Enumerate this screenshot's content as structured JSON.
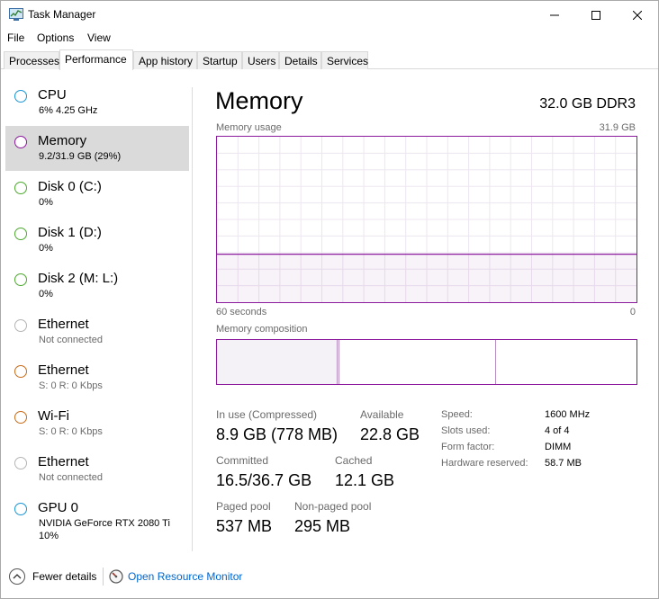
{
  "window": {
    "title": "Task Manager",
    "controls": {
      "minimize_icon": "minimize-icon",
      "maximize_icon": "maximize-icon",
      "close_icon": "close-icon"
    }
  },
  "menu": {
    "file": "File",
    "options": "Options",
    "view": "View"
  },
  "tabs": [
    "Processes",
    "Performance",
    "App history",
    "Startup",
    "Users",
    "Details",
    "Services"
  ],
  "active_tab": "Performance",
  "sidebar": {
    "items": [
      {
        "title": "CPU",
        "sub": "6% 4.25 GHz",
        "color": "#1a95d6"
      },
      {
        "title": "Memory",
        "sub": "9.2/31.9 GB (29%)",
        "color": "#8b1a9c"
      },
      {
        "title": "Disk 0 (C:)",
        "sub": "0%",
        "color": "#4da82e"
      },
      {
        "title": "Disk 1 (D:)",
        "sub": "0%",
        "color": "#4da82e"
      },
      {
        "title": "Disk 2 (M: L:)",
        "sub": "0%",
        "color": "#4da82e"
      },
      {
        "title": "Ethernet",
        "sub": "Not connected",
        "color": "#b4b4b4"
      },
      {
        "title": "Ethernet",
        "sub": "S: 0 R: 0 Kbps",
        "color": "#c96c1a"
      },
      {
        "title": "Wi-Fi",
        "sub": "S: 0 R: 0 Kbps",
        "color": "#c96c1a"
      },
      {
        "title": "Ethernet",
        "sub": "Not connected",
        "color": "#b4b4b4"
      },
      {
        "title": "GPU 0",
        "sub": "NVIDIA GeForce RTX 2080 Ti",
        "sub2": "10%",
        "color": "#1a95d6"
      }
    ]
  },
  "main": {
    "title": "Memory",
    "spec": "32.0 GB DDR3",
    "usage_label": "Memory usage",
    "usage_max": "31.9 GB",
    "time_left": "60 seconds",
    "time_right": "0",
    "usage_fraction": 0.29,
    "composition_label": "Memory composition",
    "accent": "#8b1a9c",
    "stats": {
      "in_use_label": "In use (Compressed)",
      "in_use_value": "8.9 GB (778 MB)",
      "available_label": "Available",
      "available_value": "22.8 GB",
      "committed_label": "Committed",
      "committed_value": "16.5/36.7 GB",
      "cached_label": "Cached",
      "cached_value": "12.1 GB",
      "paged_label": "Paged pool",
      "paged_value": "537 MB",
      "nonpaged_label": "Non-paged pool",
      "nonpaged_value": "295 MB"
    },
    "details": {
      "speed_label": "Speed:",
      "speed_value": "1600 MHz",
      "slots_label": "Slots used:",
      "slots_value": "4 of 4",
      "form_label": "Form factor:",
      "form_value": "DIMM",
      "hwres_label": "Hardware reserved:",
      "hwres_value": "58.7 MB"
    }
  },
  "footer": {
    "fewer_details": "Fewer details",
    "open_resource_monitor": "Open Resource Monitor"
  }
}
